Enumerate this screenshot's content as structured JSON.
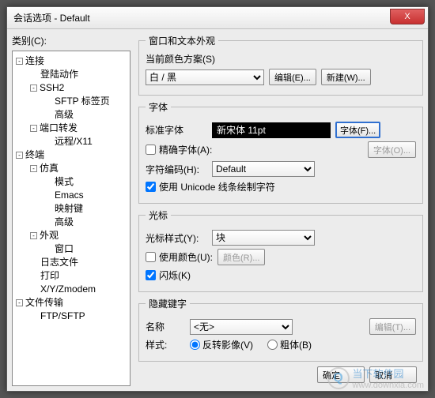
{
  "title": "会话选项 - Default",
  "close": "X",
  "category_label": "类别(C):",
  "tree": [
    {
      "lvl": 0,
      "tog": "-",
      "label": "连接"
    },
    {
      "lvl": 1,
      "tog": "",
      "label": "登陆动作"
    },
    {
      "lvl": 1,
      "tog": "-",
      "label": "SSH2"
    },
    {
      "lvl": 2,
      "tog": "",
      "label": "SFTP 标签页"
    },
    {
      "lvl": 2,
      "tog": "",
      "label": "高级"
    },
    {
      "lvl": 1,
      "tog": "-",
      "label": "端口转发"
    },
    {
      "lvl": 2,
      "tog": "",
      "label": "远程/X11"
    },
    {
      "lvl": 0,
      "tog": "-",
      "label": "终端"
    },
    {
      "lvl": 1,
      "tog": "-",
      "label": "仿真"
    },
    {
      "lvl": 2,
      "tog": "",
      "label": "模式"
    },
    {
      "lvl": 2,
      "tog": "",
      "label": "Emacs"
    },
    {
      "lvl": 2,
      "tog": "",
      "label": "映射键"
    },
    {
      "lvl": 2,
      "tog": "",
      "label": "高级"
    },
    {
      "lvl": 1,
      "tog": "-",
      "label": "外观"
    },
    {
      "lvl": 2,
      "tog": "",
      "label": "窗口"
    },
    {
      "lvl": 1,
      "tog": "",
      "label": "日志文件"
    },
    {
      "lvl": 1,
      "tog": "",
      "label": "打印"
    },
    {
      "lvl": 1,
      "tog": "",
      "label": "X/Y/Zmodem"
    },
    {
      "lvl": 0,
      "tog": "-",
      "label": "文件传输"
    },
    {
      "lvl": 1,
      "tog": "",
      "label": "FTP/SFTP"
    }
  ],
  "group_appearance": {
    "legend": "窗口和文本外观",
    "scheme_label": "当前颜色方案(S)",
    "scheme_value": "白 / 黑",
    "edit_btn": "编辑(E)...",
    "new_btn": "新建(W)..."
  },
  "group_font": {
    "legend": "字体",
    "std_label": "标准字体",
    "sample": "新宋体 11pt",
    "font_btn": "字体(F)...",
    "precise_chk": "精确字体(A):",
    "font_btn2": "字体(O)...",
    "encoding_label": "字符编码(H):",
    "encoding_value": "Default",
    "unicode_chk": "使用 Unicode 线条绘制字符"
  },
  "group_cursor": {
    "legend": "光标",
    "style_label": "光标样式(Y):",
    "style_value": "块",
    "usecolor_chk": "使用颜色(U):",
    "color_btn": "颜色(R)...",
    "blink_chk": "闪烁(K)"
  },
  "group_hidden": {
    "legend": "隐藏键字",
    "name_label": "名称",
    "name_value": "<无>",
    "edit_btn": "编辑(T)...",
    "style_label": "样式:",
    "radio1": "反转影像(V)",
    "radio2": "粗体(B)"
  },
  "footer": {
    "ok": "确定",
    "cancel": "取消"
  },
  "watermark": {
    "brand": "当下软件园",
    "url": "www.downxia.com"
  }
}
